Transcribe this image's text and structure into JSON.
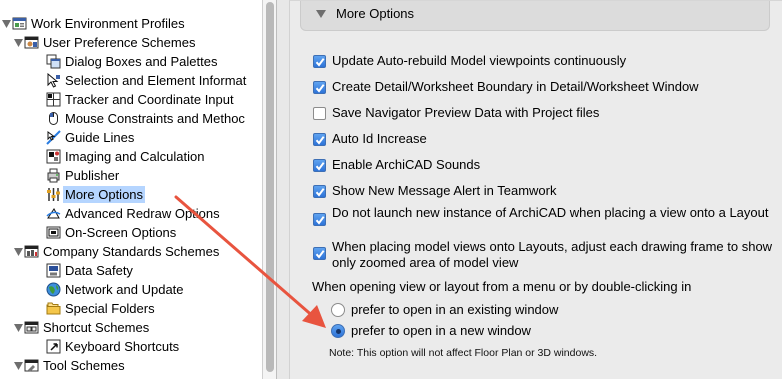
{
  "tree": {
    "items": [
      {
        "label": "Work Environment Profiles",
        "icon": "profiles-icon",
        "expanded": true,
        "depth": 0
      },
      {
        "label": "User Preference Schemes",
        "icon": "user-scheme-icon",
        "expanded": true,
        "depth": 1
      },
      {
        "label": "Dialog Boxes and Palettes",
        "icon": "dialog-boxes-icon",
        "depth": 2
      },
      {
        "label": "Selection and Element Informat",
        "icon": "selection-icon",
        "depth": 2
      },
      {
        "label": "Tracker and Coordinate Input",
        "icon": "tracker-icon",
        "depth": 2
      },
      {
        "label": "Mouse Constraints and Methoc",
        "icon": "mouse-icon",
        "depth": 2
      },
      {
        "label": "Guide Lines",
        "icon": "guide-lines-icon",
        "depth": 2
      },
      {
        "label": "Imaging and Calculation",
        "icon": "imaging-icon",
        "depth": 2
      },
      {
        "label": "Publisher",
        "icon": "publisher-icon",
        "depth": 2
      },
      {
        "label": "More Options",
        "icon": "more-options-icon",
        "depth": 2,
        "selected": true
      },
      {
        "label": "Advanced Redraw Options",
        "icon": "redraw-icon",
        "depth": 2
      },
      {
        "label": "On-Screen Options",
        "icon": "on-screen-icon",
        "depth": 2
      },
      {
        "label": "Company Standards Schemes",
        "icon": "company-scheme-icon",
        "expanded": true,
        "depth": 1
      },
      {
        "label": "Data Safety",
        "icon": "data-safety-icon",
        "depth": 2
      },
      {
        "label": "Network and Update",
        "icon": "network-icon",
        "depth": 2
      },
      {
        "label": "Special Folders",
        "icon": "folders-icon",
        "depth": 2
      },
      {
        "label": "Shortcut Schemes",
        "icon": "shortcut-scheme-icon",
        "expanded": true,
        "depth": 1
      },
      {
        "label": "Keyboard Shortcuts",
        "icon": "keyboard-icon",
        "depth": 2
      },
      {
        "label": "Tool Schemes",
        "icon": "tool-scheme-icon",
        "expanded": true,
        "depth": 1
      }
    ]
  },
  "panel": {
    "header": "More Options",
    "options": [
      {
        "label": "Update Auto-rebuild Model viewpoints continuously",
        "checked": true
      },
      {
        "label": "Create Detail/Worksheet Boundary in Detail/Worksheet Window",
        "checked": true
      },
      {
        "label": "Save Navigator Preview Data with Project files",
        "checked": false
      },
      {
        "label": "Auto Id Increase",
        "checked": true
      },
      {
        "label": "Enable ArchiCAD Sounds",
        "checked": true
      },
      {
        "label": "Show New Message Alert in Teamwork",
        "checked": true
      },
      {
        "label": "Do not launch new instance of ArchiCAD when placing a view onto a Layout",
        "checked": true
      },
      {
        "label": "When placing model views onto Layouts, adjust each drawing frame to show only zoomed area of model view",
        "checked": true
      }
    ],
    "open_prompt": "When opening view or layout from a menu or by double-clicking in",
    "radios": [
      {
        "label": "prefer to open in an existing window",
        "selected": false
      },
      {
        "label": "prefer to open in a new window",
        "selected": true
      }
    ],
    "note": "Note: This option will not affect Floor Plan or 3D windows."
  },
  "colors": {
    "selection": "#b5d5ff",
    "accent_blue": "#2d73d8",
    "annotation_arrow": "#e8543f"
  }
}
